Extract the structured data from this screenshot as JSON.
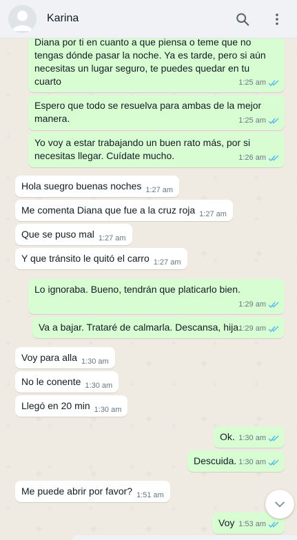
{
  "header": {
    "contact_name": "Karina",
    "avatar_icon": "default-avatar-icon",
    "search_icon": "search-icon",
    "menu_icon": "more-vertical-icon"
  },
  "colors": {
    "outgoing_bubble": "#d9fdd3",
    "incoming_bubble": "#ffffff",
    "read_ticks": "#53bdeb",
    "chat_background": "#efeae2"
  },
  "messages": [
    {
      "dir": "out",
      "text": "Diana por ti en cuanto a que piensa o teme que no tengas dónde pasar la noche. Ya es tarde, pero si aún necesitas un lugar seguro, te puedes quedar en tu cuarto",
      "time": "1:25 am",
      "status": "read"
    },
    {
      "dir": "out",
      "text": "Espero que todo se resuelva para ambas de la mejor manera.",
      "time": "1:25 am",
      "status": "read"
    },
    {
      "dir": "out",
      "text": "Yo voy a estar trabajando un buen rato más, por si necesitas llegar. Cuídate mucho.",
      "time": "1:26 am",
      "status": "read"
    },
    {
      "dir": "in",
      "text": "Hola suegro buenas noches",
      "time": "1:27 am"
    },
    {
      "dir": "in",
      "text": "Me comenta Diana que fue a la cruz roja",
      "time": "1:27 am"
    },
    {
      "dir": "in",
      "text": "Que se puso mal",
      "time": "1:27 am"
    },
    {
      "dir": "in",
      "text": "Y que tránsito le quitó el carro",
      "time": "1:27 am"
    },
    {
      "dir": "out",
      "text": "Lo ignoraba. Bueno, tendrán que platicarlo bien.",
      "time": "1:29 am",
      "status": "read"
    },
    {
      "dir": "out",
      "text": "Va a bajar. Trataré de calmarla. Descansa, hija.",
      "time": "1:29 am",
      "status": "read"
    },
    {
      "dir": "in",
      "text": "Voy para alla",
      "time": "1:30 am"
    },
    {
      "dir": "in",
      "text": "No le conente",
      "time": "1:30 am"
    },
    {
      "dir": "in",
      "text": "Llegó en 20 min",
      "time": "1:30 am"
    },
    {
      "dir": "out",
      "text": "Ok.",
      "time": "1:30 am",
      "status": "read"
    },
    {
      "dir": "out",
      "text": "Descuida.",
      "time": "1:30 am",
      "status": "read"
    },
    {
      "dir": "in",
      "text": "Me puede abrir por favor?",
      "time": "1:51 am"
    },
    {
      "dir": "out",
      "text": "Voy",
      "time": "1:53 am",
      "status": "read"
    }
  ],
  "scroll_button_icon": "chevron-down-icon"
}
